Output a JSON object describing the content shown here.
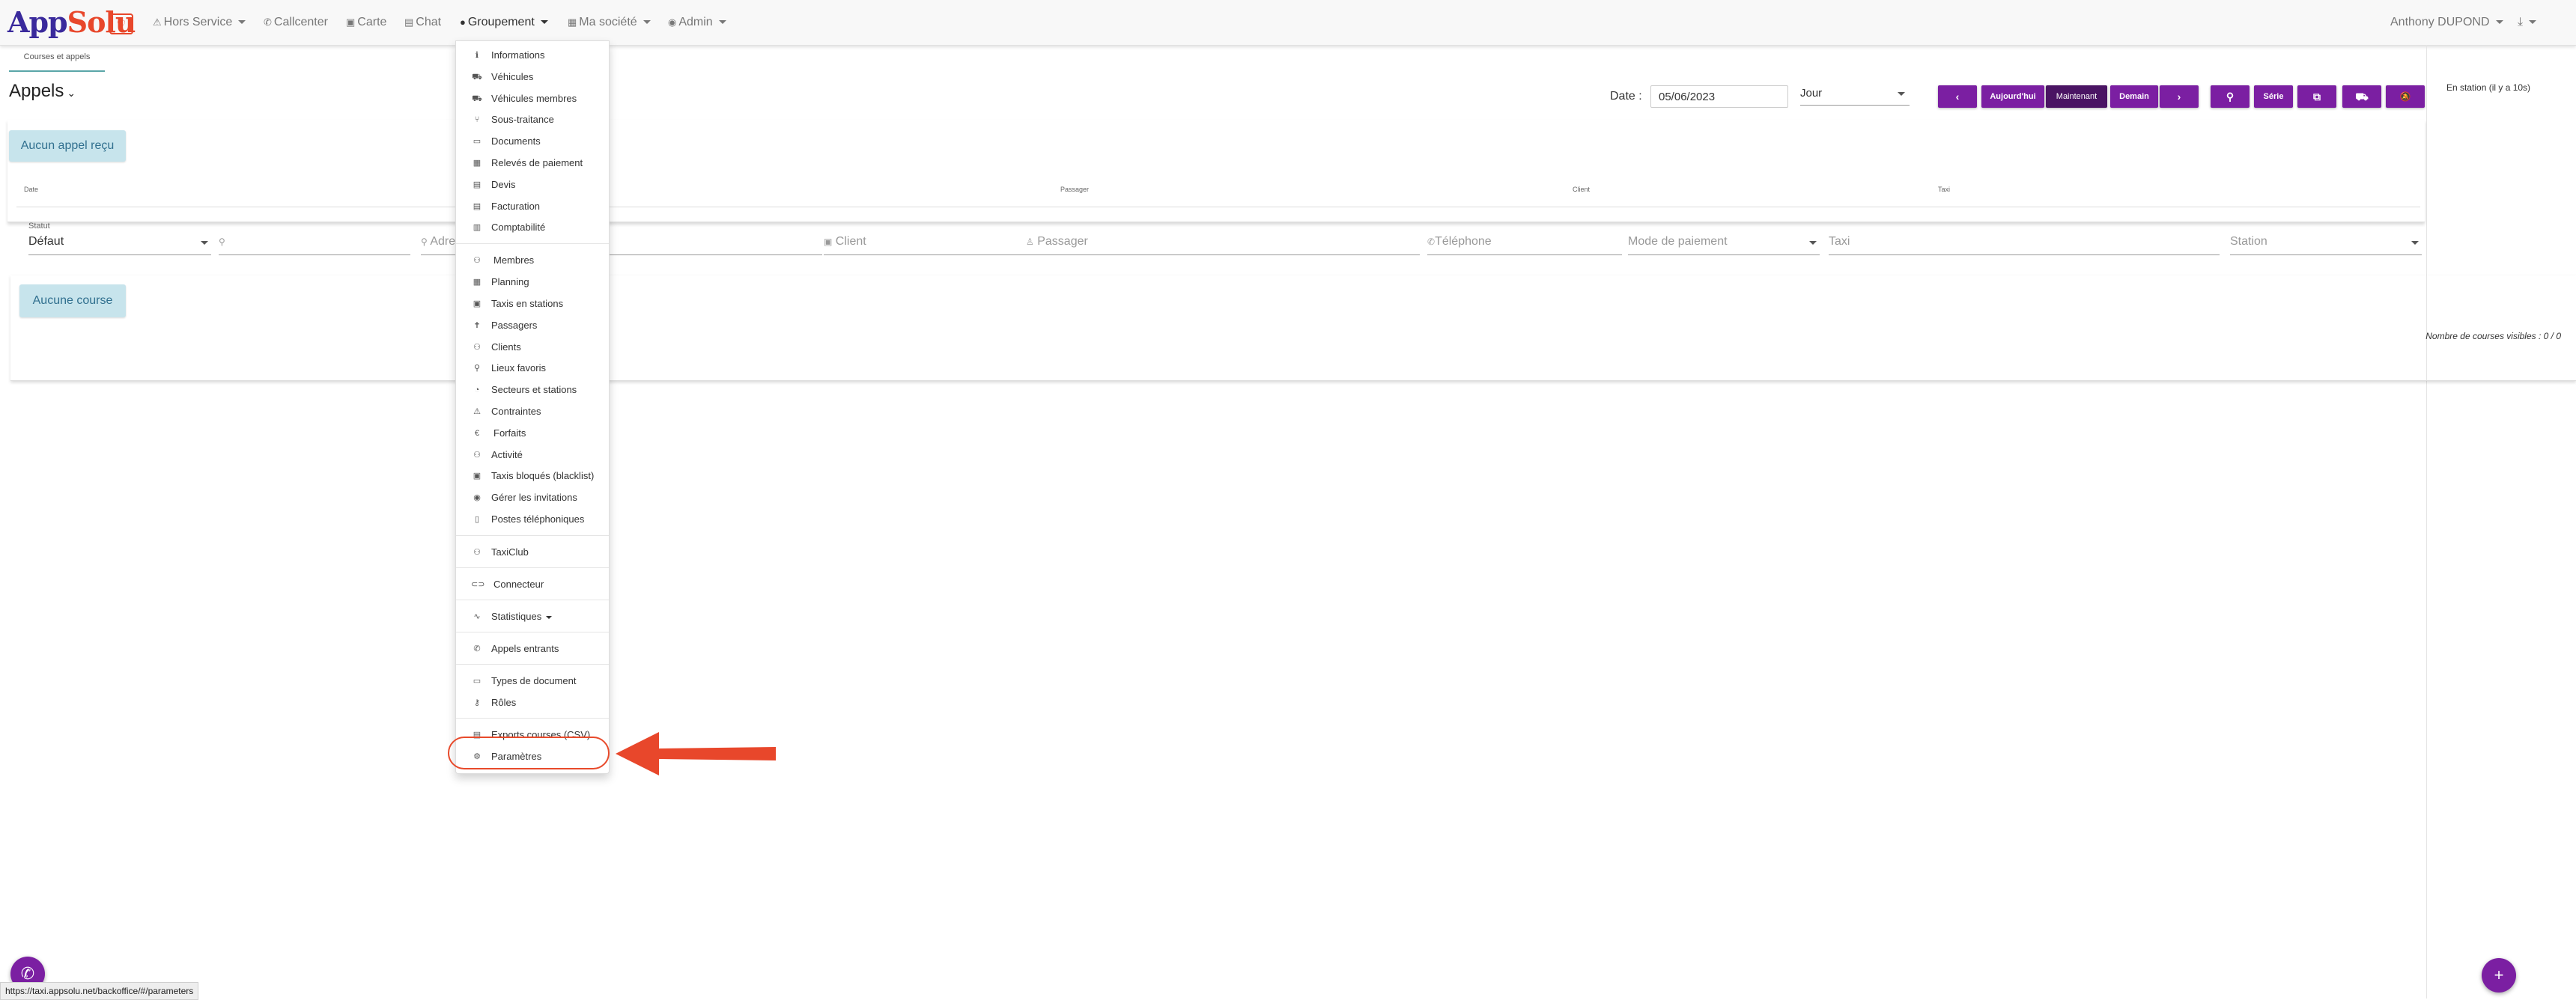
{
  "navbar": {
    "logo_text_app": "App",
    "logo_text_solu": "Solu",
    "logo_badge": "♡",
    "items": [
      {
        "icon": "⚠",
        "label": "Hors Service",
        "dropdown": true
      },
      {
        "icon": "✆",
        "label": "Callcenter",
        "dropdown": false
      },
      {
        "icon": "▣",
        "label": "Carte",
        "dropdown": false
      },
      {
        "icon": "▤",
        "label": "Chat",
        "dropdown": false
      },
      {
        "icon": "●",
        "label": "Groupement",
        "dropdown": true
      },
      {
        "icon": "▦",
        "label": "Ma société",
        "dropdown": true
      },
      {
        "icon": "◉",
        "label": "Admin",
        "dropdown": true
      }
    ],
    "user": "Anthony DUPOND",
    "download_icon": "⤓"
  },
  "subtab": "Courses et appels",
  "page_title": "Appels",
  "date": {
    "label": "Date :",
    "value": "05/06/2023"
  },
  "period": "Jour",
  "buttons": {
    "prev": "‹",
    "today": "Aujourd'hui",
    "now": "Maintenant",
    "tomorrow": "Demain",
    "next": "›",
    "search": "⚲",
    "serie": "Série",
    "external": "⧉",
    "car": "⛟",
    "bell_off": "🔕"
  },
  "right_panel": {
    "status": "En station (il y a 10s)"
  },
  "calls": {
    "empty": "Aucun appel reçu",
    "columns": [
      "Date",
      "Passager",
      "Client",
      "Taxi"
    ]
  },
  "filters": {
    "statut_label": "Statut",
    "statut_value": "Défaut",
    "search_icon": "⚲",
    "address": "Adre",
    "client": "Client",
    "passager": "Passager",
    "telephone": "Téléphone",
    "mode_paiement": "Mode de paiement",
    "taxi": "Taxi",
    "station": "Station"
  },
  "courses": {
    "empty": "Aucune course",
    "visible_count": "Nombre de courses visibles : 0 / 0"
  },
  "menu": {
    "items": [
      {
        "icon": "ℹ",
        "label": "Informations"
      },
      {
        "icon": "⛟",
        "label": "Véhicules"
      },
      {
        "icon": "⛟",
        "label": "Véhicules membres"
      },
      {
        "icon": "⑂",
        "label": "Sous-traitance"
      },
      {
        "icon": "▭",
        "label": "Documents"
      },
      {
        "icon": "▦",
        "label": "Relevés de paiement"
      },
      {
        "icon": "▤",
        "label": "Devis"
      },
      {
        "icon": "▤",
        "label": "Facturation"
      },
      {
        "icon": "▥",
        "label": "Comptabilité"
      },
      {
        "icon": "⚇",
        "label": "Membres"
      },
      {
        "icon": "▦",
        "label": "Planning"
      },
      {
        "icon": "▣",
        "label": "Taxis en stations"
      },
      {
        "icon": "✝",
        "label": "Passagers"
      },
      {
        "icon": "⚇",
        "label": "Clients"
      },
      {
        "icon": "⚲",
        "label": "Lieux favoris"
      },
      {
        "icon": "◔",
        "label": "Secteurs et stations"
      },
      {
        "icon": "⚠",
        "label": "Contraintes"
      },
      {
        "icon": "€",
        "label": "Forfaits"
      },
      {
        "icon": "⚇",
        "label": "Activité"
      },
      {
        "icon": "▣",
        "label": "Taxis bloqués (blacklist)"
      },
      {
        "icon": "◉",
        "label": "Gérer les invitations"
      },
      {
        "icon": "▯",
        "label": "Postes téléphoniques"
      },
      {
        "icon": "⚇",
        "label": "TaxiClub"
      },
      {
        "icon": "⊂⊃",
        "label": "Connecteur"
      },
      {
        "icon": "∿",
        "label": "Statistiques"
      },
      {
        "icon": "✆",
        "label": "Appels entrants"
      },
      {
        "icon": "▭",
        "label": "Types de document"
      },
      {
        "icon": "⚷",
        "label": "Rôles"
      },
      {
        "icon": "▤",
        "label": "Exports courses (CSV)"
      },
      {
        "icon": "⚙",
        "label": "Paramètres"
      }
    ]
  },
  "fab_left_icon": "✆",
  "fab_right_icon": "+",
  "status_url": "https://taxi.appsolu.net/backoffice/#/parameters",
  "colors": {
    "primary": "#7b1fa2",
    "primary_dark": "#4a1463",
    "highlight": "#e84a2b",
    "info_bg": "#c7e4ec"
  }
}
